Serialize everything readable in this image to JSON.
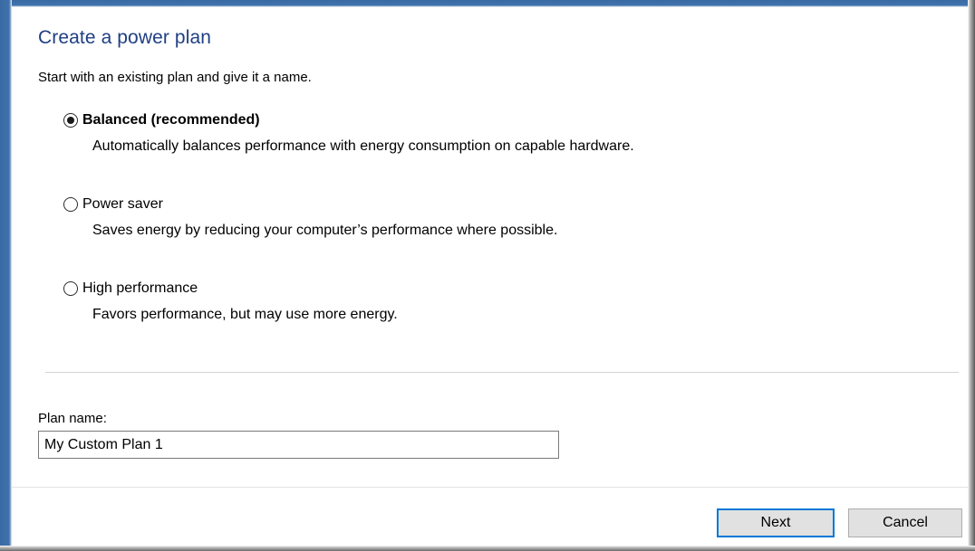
{
  "dialog": {
    "title": "Create a power plan",
    "instructions": "Start with an existing plan and give it a name."
  },
  "plans": [
    {
      "label": "Balanced (recommended)",
      "description": "Automatically balances performance with energy consumption on capable hardware.",
      "selected": true
    },
    {
      "label": "Power saver",
      "description": "Saves energy by reducing your computer’s performance where possible.",
      "selected": false
    },
    {
      "label": "High performance",
      "description": "Favors performance, but may use more energy.",
      "selected": false
    }
  ],
  "plan_name": {
    "label": "Plan name:",
    "value": "My Custom Plan 1"
  },
  "buttons": {
    "next": "Next",
    "cancel": "Cancel"
  },
  "colors": {
    "title": "#1f3f83",
    "focus_border": "#0078d7",
    "window_frame": "#3e72ad"
  }
}
